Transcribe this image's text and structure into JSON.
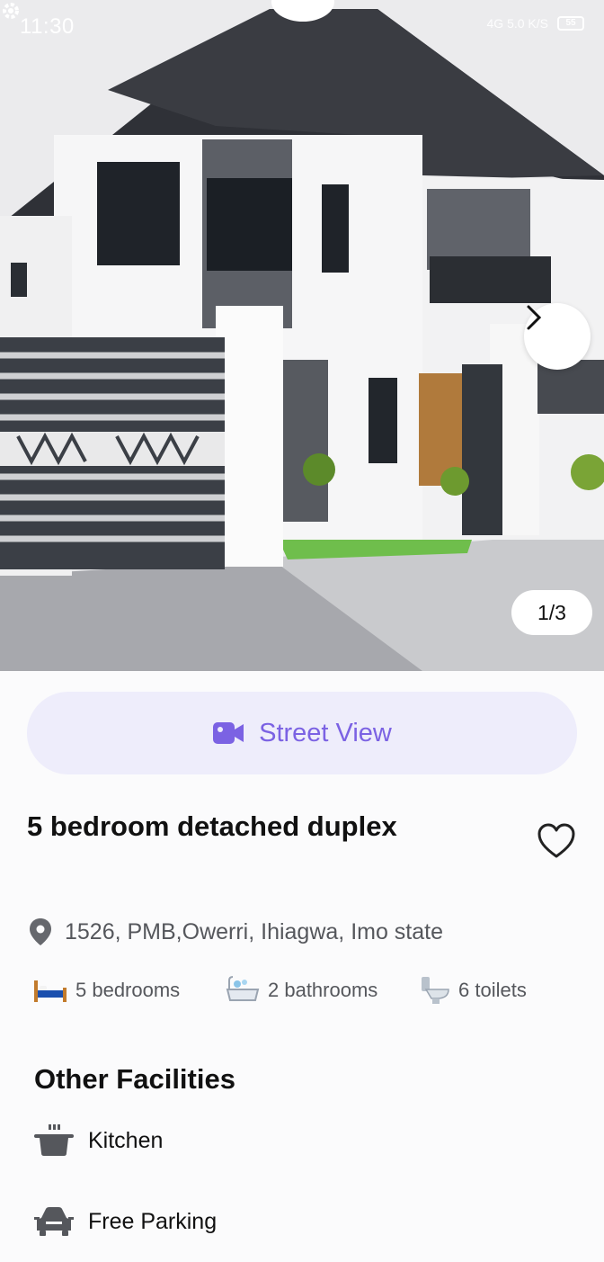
{
  "status_bar": {
    "time": "11:30",
    "indicators": "4G 5.0 K/S",
    "battery": "55"
  },
  "gallery": {
    "counter": "1/3",
    "next_icon": "chevron-right-icon"
  },
  "street_view": {
    "label": "Street View",
    "icon": "video-camera-icon",
    "accent": "#7b62e3",
    "bg": "#eeedfb"
  },
  "listing": {
    "title": "5 bedroom detached duplex",
    "address": "1526, PMB,Owerri, Ihiagwa, Imo state",
    "features": [
      {
        "icon": "bed-icon",
        "label": "5 bedrooms"
      },
      {
        "icon": "bathtub-icon",
        "label": "2 bathrooms"
      },
      {
        "icon": "toilet-icon",
        "label": "6 toilets"
      }
    ]
  },
  "facilities": {
    "title": "Other Facilities",
    "items": [
      {
        "icon": "cooking-pot-icon",
        "label": "Kitchen"
      },
      {
        "icon": "car-icon",
        "label": "Free Parking"
      }
    ]
  }
}
